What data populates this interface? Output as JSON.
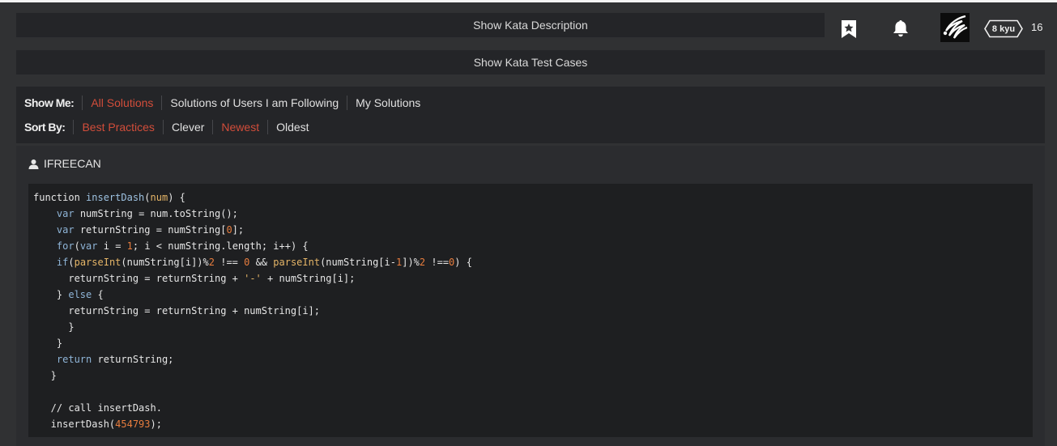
{
  "header": {
    "rank_label": "8 kyu",
    "honor": "16",
    "icons": [
      "bookmark-star-icon",
      "bell-icon",
      "avatar-logo"
    ]
  },
  "toggles": {
    "description": "Show Kata Description",
    "test_cases": "Show Kata Test Cases"
  },
  "filters": {
    "show_me_label": "Show Me:",
    "show_me_options": [
      "All Solutions",
      "Solutions of Users I am Following",
      "My Solutions"
    ],
    "show_me_active": "All Solutions",
    "sort_by_label": "Sort By:",
    "sort_by_options": [
      "Best Practices",
      "Clever",
      "Newest",
      "Oldest"
    ],
    "sort_by_active": [
      "Best Practices",
      "Newest"
    ]
  },
  "solution": {
    "user": "IFREECAN",
    "code_lines": [
      "function insertDash(num) {",
      "    var numString = num.toString();",
      "    var returnString = numString[0];",
      "    for(var i = 1; i < numString.length; i++) {",
      "    if(parseInt(numString[i])%2 !== 0 && parseInt(numString[i-1])%2 !==0) {",
      "      returnString = returnString + '-' + numString[i];",
      "    } else {",
      "      returnString = returnString + numString[i];",
      "      }",
      "    }",
      "    return returnString;",
      "   }",
      "",
      "   // call insertDash.",
      "   insertDash(454793);"
    ]
  },
  "colors": {
    "accent_red": "#d24d3a",
    "panel": "#242528",
    "code_bg": "#1e1f21"
  }
}
